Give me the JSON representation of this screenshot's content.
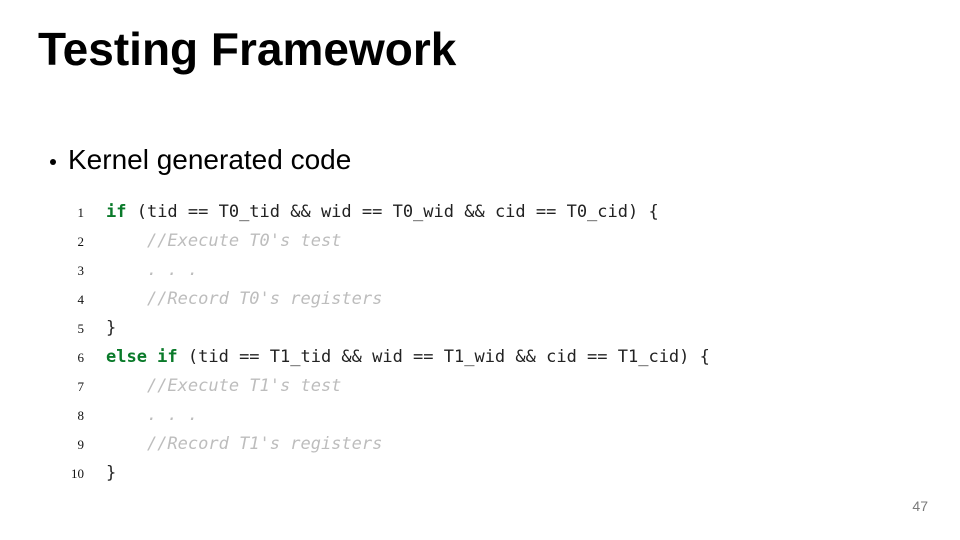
{
  "title": "Testing Framework",
  "bullet": "Kernel generated code",
  "code": {
    "lines": [
      {
        "n": "1",
        "indent": "",
        "segments": [
          {
            "cls": "kw",
            "t": "if"
          },
          {
            "cls": "plain",
            "t": " (tid == T0_tid && wid == T0_wid && cid == T0_cid) {"
          }
        ]
      },
      {
        "n": "2",
        "indent": "    ",
        "segments": [
          {
            "cls": "cmt",
            "t": "//Execute T0's test"
          }
        ]
      },
      {
        "n": "3",
        "indent": "    ",
        "segments": [
          {
            "cls": "cmt",
            "t": ". . ."
          }
        ]
      },
      {
        "n": "4",
        "indent": "    ",
        "segments": [
          {
            "cls": "cmt",
            "t": "//Record T0's registers"
          }
        ]
      },
      {
        "n": "5",
        "indent": "",
        "segments": [
          {
            "cls": "plain",
            "t": "}"
          }
        ]
      },
      {
        "n": "6",
        "indent": "",
        "segments": [
          {
            "cls": "kw",
            "t": "else if"
          },
          {
            "cls": "plain",
            "t": " (tid == T1_tid && wid == T1_wid && cid == T1_cid) {"
          }
        ]
      },
      {
        "n": "7",
        "indent": "    ",
        "segments": [
          {
            "cls": "cmt",
            "t": "//Execute T1's test"
          }
        ]
      },
      {
        "n": "8",
        "indent": "    ",
        "segments": [
          {
            "cls": "cmt",
            "t": ". . ."
          }
        ]
      },
      {
        "n": "9",
        "indent": "    ",
        "segments": [
          {
            "cls": "cmt",
            "t": "//Record T1's registers"
          }
        ]
      },
      {
        "n": "10",
        "indent": "",
        "segments": [
          {
            "cls": "plain",
            "t": "}"
          }
        ]
      }
    ]
  },
  "page_number": "47"
}
